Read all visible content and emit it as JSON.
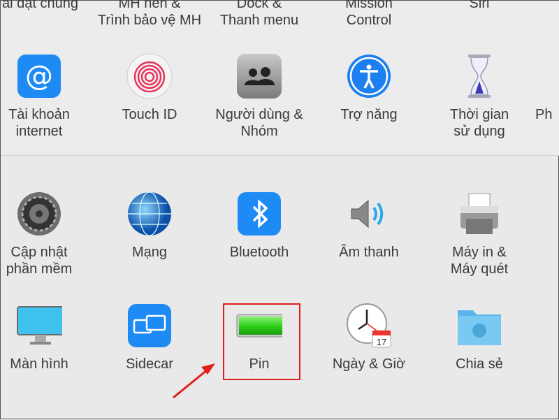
{
  "row1": [
    {
      "label": "ài đặt chung"
    },
    {
      "label": "MH nền &\nTrình bảo vệ MH"
    },
    {
      "label": "Dock &\nThanh menu"
    },
    {
      "label": "Mission\nControl"
    },
    {
      "label": "Siri"
    }
  ],
  "row2": [
    {
      "label": "Tài khoản\ninternet",
      "icon": "at-sign-icon"
    },
    {
      "label": "Touch ID",
      "icon": "fingerprint-icon"
    },
    {
      "label": "Người dùng &\nNhóm",
      "icon": "users-icon"
    },
    {
      "label": "Trợ năng",
      "icon": "accessibility-icon"
    },
    {
      "label": "Thời gian\nsử dụng",
      "icon": "hourglass-icon"
    },
    {
      "label": "Ph"
    }
  ],
  "row3": [
    {
      "label": "Cập nhật\nphần mềm",
      "icon": "gear-icon"
    },
    {
      "label": "Mạng",
      "icon": "globe-icon"
    },
    {
      "label": "Bluetooth",
      "icon": "bluetooth-icon"
    },
    {
      "label": "Âm thanh",
      "icon": "speaker-icon"
    },
    {
      "label": "Máy in &\nMáy quét",
      "icon": "printer-icon"
    }
  ],
  "row4": [
    {
      "label": "Màn hình",
      "icon": "display-icon"
    },
    {
      "label": "Sidecar",
      "icon": "sidecar-icon"
    },
    {
      "label": "Pin",
      "icon": "battery-icon"
    },
    {
      "label": "Ngày & Giờ",
      "icon": "clock-icon",
      "calendar_day": "17"
    },
    {
      "label": "Chia sẻ",
      "icon": "shared-folder-icon"
    }
  ],
  "colors": {
    "highlight": "#e0201c",
    "accent": "#1e8bf5"
  }
}
